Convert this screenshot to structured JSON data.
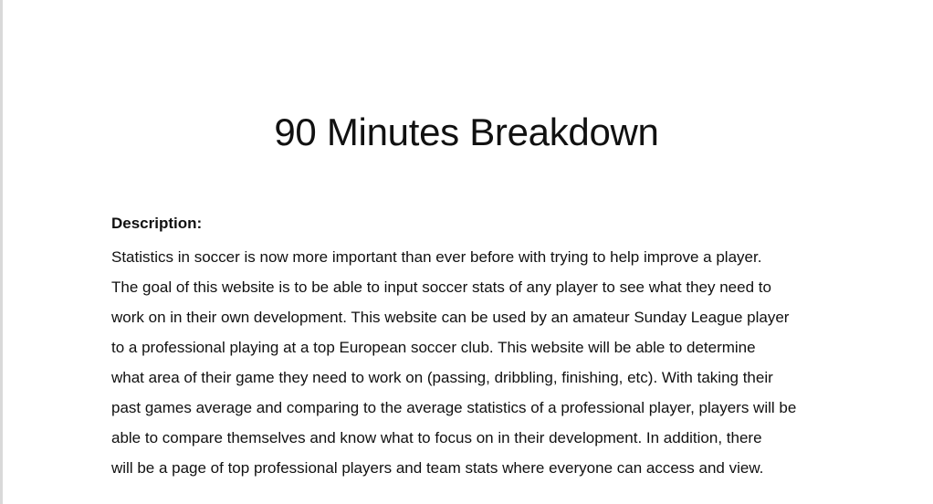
{
  "page": {
    "title": "90 Minutes Breakdown"
  },
  "description": {
    "label": "Description:",
    "lines": [
      "Statistics in soccer is now more important than ever before with trying to help improve a player.",
      "The goal of this website is to be able to input soccer stats of any player to see what they need to",
      "work on in their own development. This website can be used by an amateur Sunday League player",
      "to a professional playing at a top European soccer club. This website will be able to determine",
      "what area of their game they need to work on (passing, dribbling, finishing, etc). With taking their",
      "past games average and comparing to the average statistics of a professional player, players will be",
      "able to compare themselves and know what to focus on in their development. In addition, there",
      "will be a page of top professional players and team stats where everyone can access and view."
    ]
  }
}
